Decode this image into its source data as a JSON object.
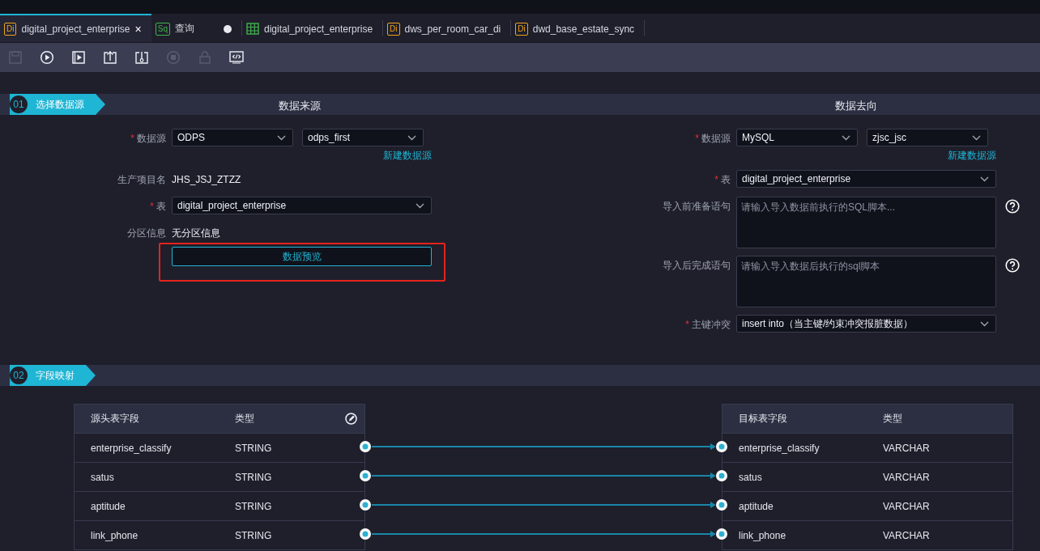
{
  "tabs": [
    {
      "kind": "di",
      "badge": "Di",
      "label": "digital_project_enterprise",
      "selected": true,
      "close": "×",
      "modified": false
    },
    {
      "kind": "sql",
      "badge": "Sq",
      "label": "查询",
      "selected": false,
      "modified": true
    },
    {
      "kind": "table",
      "label": "digital_project_enterprise",
      "selected": false,
      "modified": false
    },
    {
      "kind": "di",
      "badge": "Di",
      "label": "dws_per_room_car_di",
      "selected": false,
      "modified": false
    },
    {
      "kind": "di",
      "badge": "Di",
      "label": "dwd_base_estate_sync",
      "selected": false,
      "modified": false
    }
  ],
  "toolbar": [
    {
      "kind": "save",
      "disabled": true
    },
    {
      "kind": "run",
      "disabled": false
    },
    {
      "kind": "run_params",
      "disabled": false
    },
    {
      "kind": "submit",
      "disabled": false
    },
    {
      "kind": "deploy",
      "disabled": false
    },
    {
      "kind": "stop",
      "disabled": true
    },
    {
      "kind": "lock",
      "disabled": true
    },
    {
      "kind": "code",
      "disabled": false
    }
  ],
  "step_1": {
    "number": "01",
    "title": "选择数据源",
    "source": {
      "heading": "数据来源",
      "fields": [
        {
          "kind": "select_pair",
          "label": "数据源",
          "required_mark": "*",
          "values": [
            "ODPS",
            "odps_first"
          ],
          "link": "新建数据源"
        },
        {
          "kind": "text",
          "label": "生产项目名",
          "value": "JHS_JSJ_ZTZZ"
        },
        {
          "kind": "select",
          "label": "表",
          "required_mark": "*",
          "value": "digital_project_enterprise"
        },
        {
          "kind": "text",
          "label": "分区信息",
          "value": "无分区信息"
        }
      ],
      "preview_button": "数据预览",
      "preview_highlighted": true
    },
    "target": {
      "heading": "数据去向",
      "fields": [
        {
          "kind": "select_pair",
          "label": "数据源",
          "required_mark": "*",
          "values": [
            "MySQL",
            "zjsc_jsc"
          ],
          "link": "新建数据源"
        },
        {
          "kind": "select",
          "label": "表",
          "required_mark": "*",
          "value": "digital_project_enterprise"
        },
        {
          "kind": "textarea",
          "label": "导入前准备语句",
          "placeholder": "请输入导入数据前执行的SQL脚本...",
          "help": true
        },
        {
          "kind": "textarea",
          "label": "导入后完成语句",
          "placeholder": "请输入导入数据后执行的sql脚本",
          "help": true
        },
        {
          "kind": "select",
          "label": "主键冲突",
          "required_mark": "*",
          "value": "insert into（当主键/约束冲突报脏数据）"
        }
      ]
    }
  },
  "step_2": {
    "number": "02",
    "title": "字段映射",
    "source_columns": [
      "源头表字段",
      "类型"
    ],
    "target_columns": [
      "目标表字段",
      "类型"
    ],
    "rows": [
      {
        "source": "enterprise_classify",
        "source_type": "STRING",
        "target": "enterprise_classify",
        "target_type": "VARCHAR",
        "connected": true
      },
      {
        "source": "satus",
        "source_type": "STRING",
        "target": "satus",
        "target_type": "VARCHAR",
        "connected": true
      },
      {
        "source": "aptitude",
        "source_type": "STRING",
        "target": "aptitude",
        "target_type": "VARCHAR",
        "connected": true
      },
      {
        "source": "link_phone",
        "source_type": "STRING",
        "target": "link_phone",
        "target_type": "VARCHAR",
        "connected": true
      }
    ]
  }
}
